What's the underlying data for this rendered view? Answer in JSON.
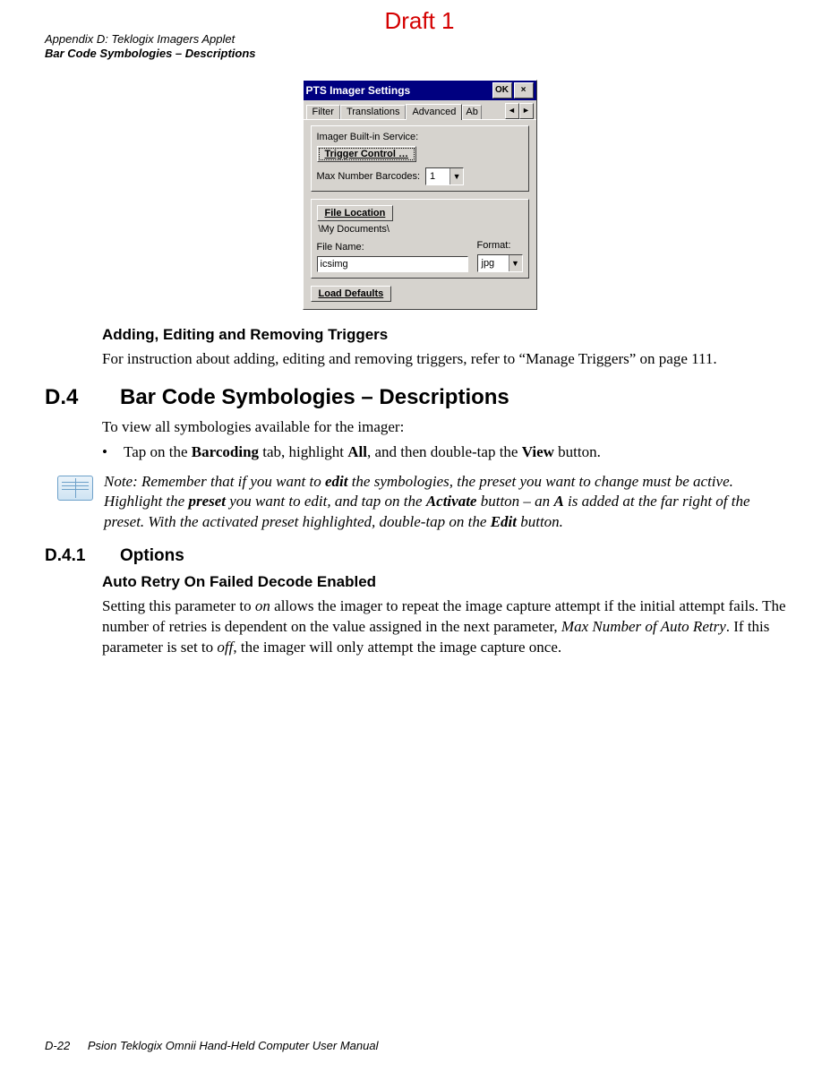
{
  "draft_label": "Draft 1",
  "header": {
    "line1": "Appendix D:  Teklogix Imagers Applet",
    "line2": "Bar Code Symbologies – Descriptions"
  },
  "dialog": {
    "title": "PTS Imager Settings",
    "ok_label": "OK",
    "close_label": "×",
    "tabs": {
      "filter": "Filter",
      "translations": "Translations",
      "advanced": "Advanced",
      "partial": "Ab"
    },
    "scroll_left": "◄",
    "scroll_right": "►",
    "svc_label": "Imager Built-in Service:",
    "trigger_btn": "Trigger Control …",
    "max_barcodes_label": "Max Number Barcodes:",
    "max_barcodes_value": "1",
    "file_location_btn": "File Location",
    "path": "\\My Documents\\",
    "file_name_label": "File Name:",
    "file_name_value": "icsimg",
    "format_label": "Format:",
    "format_value": "jpg",
    "load_defaults_btn": "Load Defaults"
  },
  "sec_triggers": {
    "heading": "Adding, Editing and Removing Triggers",
    "para": "For instruction about adding, editing and removing triggers, refer to “Manage Triggers” on page 111."
  },
  "sec_d4": {
    "num": "D.4",
    "title": "Bar Code Symbologies – Descriptions",
    "para": "To view all symbologies available for the imager:",
    "bullet_pre": "Tap on the ",
    "bullet_b1": "Barcoding",
    "bullet_mid1": " tab, highlight ",
    "bullet_b2": "All",
    "bullet_mid2": ", and then double-tap the ",
    "bullet_b3": "View",
    "bullet_end": " button."
  },
  "note": {
    "label": "Note:",
    "t1": " Remember that if you want to ",
    "b1": "edit",
    "t2": " the symbologies, the preset you want to change must be active. Highlight the ",
    "b2": "preset",
    "t3": " you want to edit, and tap on the ",
    "b3": "Activate",
    "t4": " button – an ",
    "b4": "A",
    "t5": " is added at the far right of the preset. With the activated preset highlighted, double-tap on the ",
    "b5": "Edit",
    "t6": " button."
  },
  "sec_d41": {
    "num": "D.4.1",
    "title": "Options",
    "sub": "Auto Retry On Failed Decode Enabled",
    "p1": "Setting this parameter to ",
    "i1": "on",
    "p2": " allows the imager to repeat the image capture attempt if the initial attempt fails. The number of retries is dependent on the value assigned in the next parameter, ",
    "i2": "Max Number of Auto Retry",
    "p3": ". If this parameter is set to ",
    "i3": "off",
    "p4": ", the imager will only attempt the image capture once."
  },
  "footer": {
    "page": "D-22",
    "title": "Psion Teklogix Omnii Hand-Held Computer User Manual"
  }
}
